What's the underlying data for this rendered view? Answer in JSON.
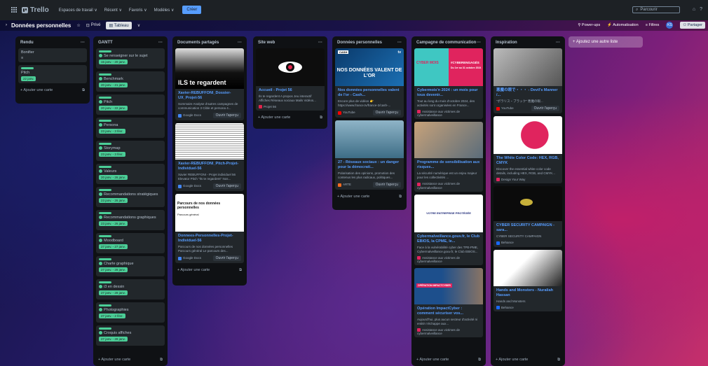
{
  "topbar": {
    "app_name": "Trello",
    "menus": [
      "Espaces de travail ∨",
      "Récent ∨",
      "Favoris ∨",
      "Modèles ∨"
    ],
    "create_label": "Créer",
    "search_placeholder": "Parcourir"
  },
  "board": {
    "title": "Données personnelles",
    "visibility": "Privé",
    "view_tab": "Tableau",
    "powerups": "Power-ups",
    "automation": "Automatisation",
    "filters": "Filtres",
    "avatar": "KS",
    "share": "Partager"
  },
  "add_list_label": "+ Ajoutez une autre liste",
  "add_card_label": "+ Ajouter une carte",
  "lists": {
    "rendu": {
      "title": "Rendu",
      "cards": [
        {
          "title": "Bonifier"
        },
        {
          "title": "Pitch",
          "due": "22 janv."
        }
      ]
    },
    "gantt": {
      "title": "GANTT",
      "cards": [
        {
          "title": "Se renseigner sur le sujet",
          "due": "15 janv. - 20 janv."
        },
        {
          "title": "Benchmark",
          "due": "20 janv. - 21 janv."
        },
        {
          "title": "Pitch",
          "due": "20 janv. - 22 janv."
        },
        {
          "title": "Persona",
          "due": "23 janv. - 3 févr."
        },
        {
          "title": "Storymap",
          "due": "23 janv. - 3 févr."
        },
        {
          "title": "Valeurs",
          "due": "20 janv. - 26 janv."
        },
        {
          "title": "Recommandations stratégiques",
          "due": "23 janv. - 26 janv."
        },
        {
          "title": "Recommandations graphiques",
          "due": "23 janv. - 26 janv."
        },
        {
          "title": "Moodboard",
          "due": "27 janv. - 27 janv."
        },
        {
          "title": "Charte graphique",
          "due": "27 janv. - 28 janv."
        },
        {
          "title": "i3 en dessin",
          "due": "27 janv. - 28 janv."
        },
        {
          "title": "Photographies",
          "due": "27 janv. - 2 févr."
        },
        {
          "title": "Croquis affiches",
          "due": "27 janv. - 28 janv."
        }
      ]
    },
    "docs": {
      "title": "Documents partagés",
      "cards": [
        {
          "title": "Xavier-REBUFFONI_Dossier-UX_Projet-56",
          "desc": "Sommaire Analyse d'autres campagnes de communication 3 Cible et persona 4...",
          "source": "Google Docs",
          "button": "Ouvrir l'aperçu"
        },
        {
          "title": "Xavier-REBUFFONI_Pitch-Projet-Individuel-56",
          "desc": "Xavier REBUFFONI - Projet individuel 56 Elevator Pitch \"Ils te regardent\" Nos...",
          "source": "Google Docs",
          "button": "Ouvrir l'aperçu"
        },
        {
          "title": "Donnees-Personnelles-Projet-Individuel-56",
          "desc": "Parcours de nos données personnelles Parcours général Le parcours des...",
          "source": "Google Docs",
          "button": "Ouvrir l'aperçu",
          "doc_heading": "Parcours de nos données personnelles",
          "doc_sub": "Parcours général"
        }
      ],
      "thumb_text": "ILS te regardent"
    },
    "site": {
      "title": "Site web",
      "cards": [
        {
          "title": "Accueil - Projet 56",
          "desc": "Ils te regardent A propos Jeu interactif Affiches Réseaux sociaux Mails Vidéos...",
          "source": "Projet 56"
        }
      ]
    },
    "donnees": {
      "title": "Données personnelles",
      "cards": [
        {
          "title": "Nos données personnelles valent de l'or - Cash...",
          "desc": "Encore plus de vidéos 👉 https://www.france.tv/france-2/cash-...",
          "source": "YouTube",
          "button": "Ouvrir l'aperçu",
          "thumb_text": "NOS DONNÉES VALENT DE L'OR",
          "badge": "CASH",
          "tag": "tv"
        },
        {
          "title": "27 - Réseaux sociaux : un danger pour la démocrati...",
          "desc": "Polarisation des opinions, promotion des contenus les plus radicaux, politiques...",
          "source": "ARTE",
          "button": "Ouvrir l'aperçu"
        }
      ]
    },
    "campagne": {
      "title": "Campagne de communication",
      "cards": [
        {
          "title": "Cybermois'n 2024 : un mois pour tous devenir...",
          "desc": "Tout au long du mois d'octobre 2024, des activités sont organisées en France...",
          "source": "Assistance aux victimes de cybermalveillance",
          "thumb_a": "CYBER MOIS",
          "thumb_b": "#CYBERENGAGÉS",
          "thumb_c": "Du 1er au 31 octobre 2024"
        },
        {
          "title": "Programme de sensibilisation aux risques...",
          "desc": "La sécurité numérique est un enjeu majeur pour les collectivités ...",
          "source": "Assistance aux victimes de cybermalveillance"
        },
        {
          "title": "Cybermalveillance.gouv.fr, le Club EBIOS, la CPME, le...",
          "desc": "Face à la vulnérabilité cyber des TPE-PME, Cybermalveillance.gouv.fr, le Club EBIOS...",
          "source": "Assistance aux victimes de cybermalveillance",
          "thumb_text": "VOTRE ENTREPRISE PROTÉGÉE"
        },
        {
          "title": "Opération ImpactCyber : comment sécuriser vos...",
          "desc": "Aujourd'hui, plus aucun secteur d'activité ni entité n'échappe aux...",
          "source": "Assistance aux victimes de cybermalveillance",
          "thumb_text": "OPÉRATION IMPACTCYBER"
        }
      ]
    },
    "inspiration": {
      "title": "Inspiration",
      "cards": [
        {
          "title": "悪魔の眼で・・・ - Devil's Manner /...",
          "desc": "\"ポラリス・ブラック\" 悪魔の眼...",
          "source": "YouTube",
          "button": "Ouvrir l'aperçu"
        },
        {
          "title": "The White Color Code: HEX, RGB, CMYK",
          "desc": "Discover the essential white color code details, including HEX, RGB, and CMYK...",
          "source": "Design Your Way"
        },
        {
          "title": "CYBER SECURITY CAMPAIGN - sara...",
          "desc": "CYBER SECURITY CAMPAIGN",
          "source": "Behance"
        },
        {
          "title": "Hands and Monsters - Nuraliah Hassan",
          "desc": "Hands and Monsters",
          "source": "Behance"
        }
      ]
    }
  },
  "colors": {
    "label_green": "#4bce97",
    "link_blue": "#579dff",
    "list_bg": "#0f1114",
    "card_bg": "#22272b"
  }
}
